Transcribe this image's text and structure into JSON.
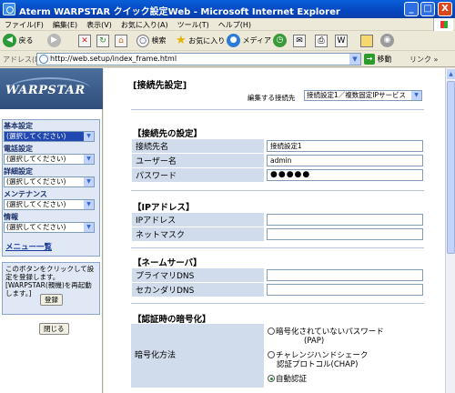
{
  "window": {
    "title": "Aterm WARPSTAR クイック設定Web - Microsoft Internet Explorer",
    "buttons": {
      "minimize": "_",
      "maximize": "□",
      "close": "X"
    }
  },
  "menubar": {
    "items": [
      "ファイル(F)",
      "編集(E)",
      "表示(V)",
      "お気に入り(A)",
      "ツール(T)",
      "ヘルプ(H)"
    ]
  },
  "toolbar": {
    "back": "戻る",
    "search": "検索",
    "favorites": "お気に入り",
    "media": "メディア"
  },
  "address": {
    "label": "アドレス(D)",
    "url": "http://web.setup/index_frame.html",
    "go": "移動",
    "links": "リンク"
  },
  "left": {
    "logo": "WARPSTAR",
    "groups": [
      {
        "label": "基本設定",
        "value": "(選択してください)"
      },
      {
        "label": "電話設定",
        "value": "(選択してください)"
      },
      {
        "label": "詳細設定",
        "value": "(選択してください)"
      },
      {
        "label": "メンテナンス",
        "value": "(選択してください)"
      },
      {
        "label": "情報",
        "value": "(選択してください)"
      }
    ],
    "menu_link": "メニュー一覧",
    "info_text": "このボタンをクリックして設定を登録します。[WARPSTAR(親機)を再起動します。]",
    "register_button": "登録",
    "close_button": "閉じる"
  },
  "main": {
    "title": "[接続先設定]",
    "edit_label": "編集する接続先",
    "edit_value": "接続設定1／複数固定IPサービス",
    "conn": {
      "heading": "【接続先の設定】",
      "rows": [
        {
          "label": "接続先名",
          "value": "接続設定1"
        },
        {
          "label": "ユーザー名",
          "value": "admin"
        },
        {
          "label": "パスワード",
          "value": "●●●●●"
        }
      ]
    },
    "ip": {
      "heading": "【IPアドレス】",
      "rows": [
        {
          "label": "IPアドレス",
          "value": ""
        },
        {
          "label": "ネットマスク",
          "value": ""
        }
      ]
    },
    "dns": {
      "heading": "【ネームサーバ】",
      "rows": [
        {
          "label": "プライマリDNS",
          "value": ""
        },
        {
          "label": "セカンダリDNS",
          "value": ""
        }
      ]
    },
    "enc": {
      "heading": "【認証時の暗号化】",
      "label": "暗号化方法",
      "options": [
        {
          "line1": "暗号化されていないパスワード",
          "line2": "(PAP)",
          "selected": false
        },
        {
          "line1": "チャレンジハンドシェーク",
          "line2": "認証プロトコル(CHAP)",
          "selected": false
        },
        {
          "line1": "自動認証",
          "line2": "",
          "selected": true
        }
      ]
    }
  }
}
